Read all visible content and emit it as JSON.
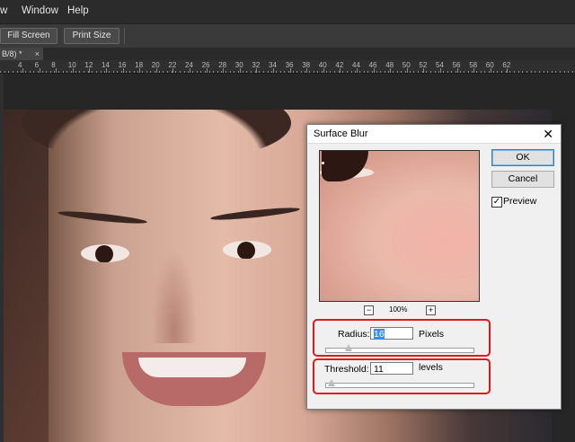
{
  "menubar": {
    "items": [
      "w",
      "Window",
      "Help"
    ]
  },
  "optionsbar": {
    "fill_screen": "Fill Screen",
    "print_size": "Print Size"
  },
  "document_tab": {
    "label": "B/8) *",
    "close": "×"
  },
  "ruler": {
    "labels": [
      "4",
      "6",
      "8",
      "10",
      "12",
      "14",
      "16",
      "18",
      "20",
      "22",
      "24",
      "26",
      "28",
      "30",
      "32",
      "34",
      "36",
      "38",
      "40",
      "42",
      "44",
      "46",
      "48",
      "50",
      "52",
      "54",
      "56",
      "58",
      "60",
      "62"
    ]
  },
  "dialog": {
    "title": "Surface Blur",
    "close": "✕",
    "ok_label": "OK",
    "cancel_label": "Cancel",
    "preview_label": "Preview",
    "preview_checked": "✓",
    "zoom": {
      "minus": "−",
      "value": "100%",
      "plus": "+"
    },
    "radius": {
      "label": "Radius:",
      "value": "16",
      "unit": "Pixels",
      "slider_fraction": 0.16
    },
    "threshold": {
      "label": "Threshold:",
      "value": "11",
      "unit": "levels",
      "slider_fraction": 0.04
    },
    "highlight_color": "#e01818"
  }
}
